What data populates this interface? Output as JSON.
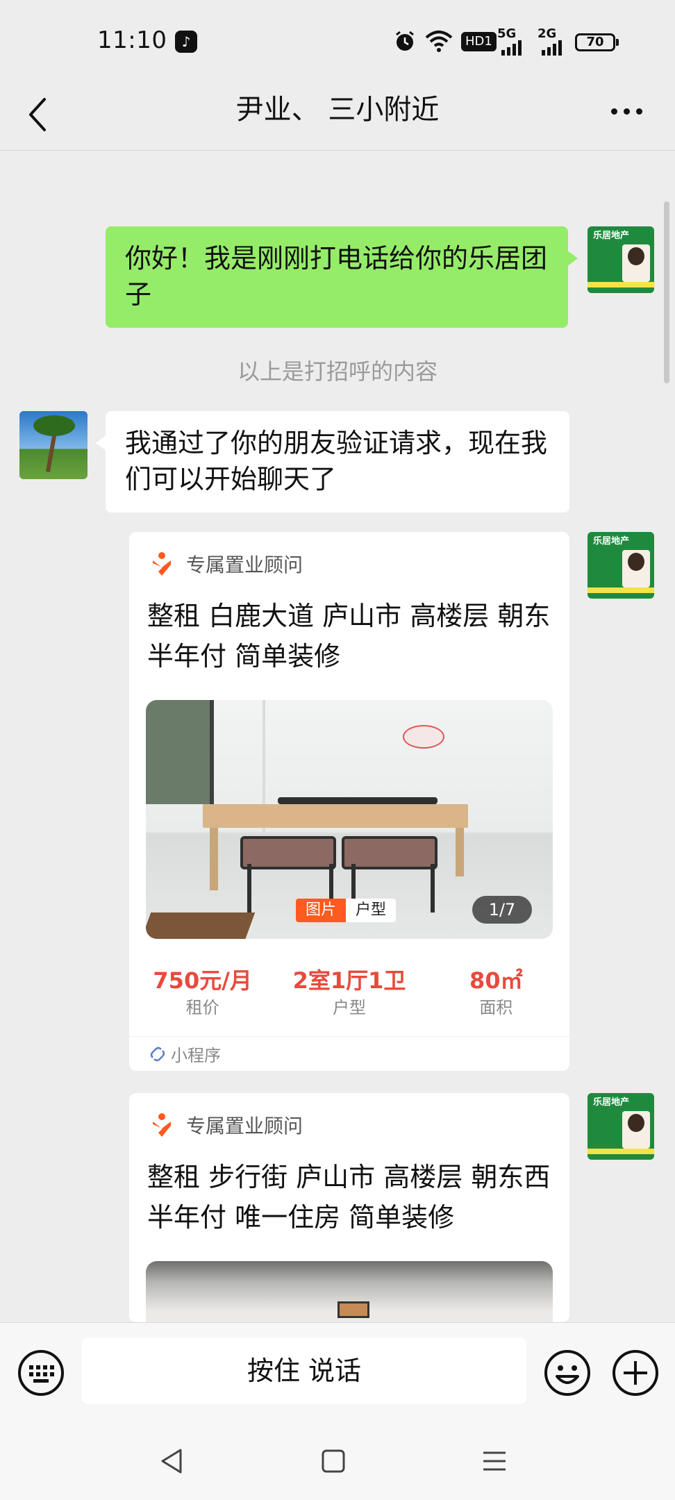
{
  "status_bar": {
    "time": "11:10",
    "app_badge": "♪",
    "hd_label": "HD1",
    "net1": "5G",
    "net2": "2G",
    "battery": "70"
  },
  "header": {
    "title": "尹业、   三小附近"
  },
  "chat": {
    "my_greeting": "你好！我是刚刚打电话给你的乐居团子",
    "system_note": "以上是打招呼的内容",
    "their_message": "我通过了你的朋友验证请求，现在我们可以开始聊天了",
    "avatar_brand": "乐居地产"
  },
  "cards": [
    {
      "source": "专属置业顾问",
      "title": "整租 白鹿大道 庐山市 高楼层 朝东 半年付 简单装修",
      "tab_active": "图片",
      "tab_inactive": "户型",
      "counter": "1/7",
      "stats": [
        {
          "value": "750元/月",
          "label": "租价"
        },
        {
          "value": "2室1厅1卫",
          "label": "户型"
        },
        {
          "value": "80㎡",
          "label": "面积"
        }
      ],
      "mini_program": "小程序"
    },
    {
      "source": "专属置业顾问",
      "title": "整租 步行街 庐山市 高楼层 朝东西 半年付 唯一住房 简单装修"
    }
  ],
  "input_bar": {
    "voice_label": "按住 说话"
  },
  "colors": {
    "my_bubble": "#95ec69",
    "accent_orange": "#ff5a1f",
    "price_red": "#e84a3d",
    "avatar_green": "#1f8a3e"
  }
}
